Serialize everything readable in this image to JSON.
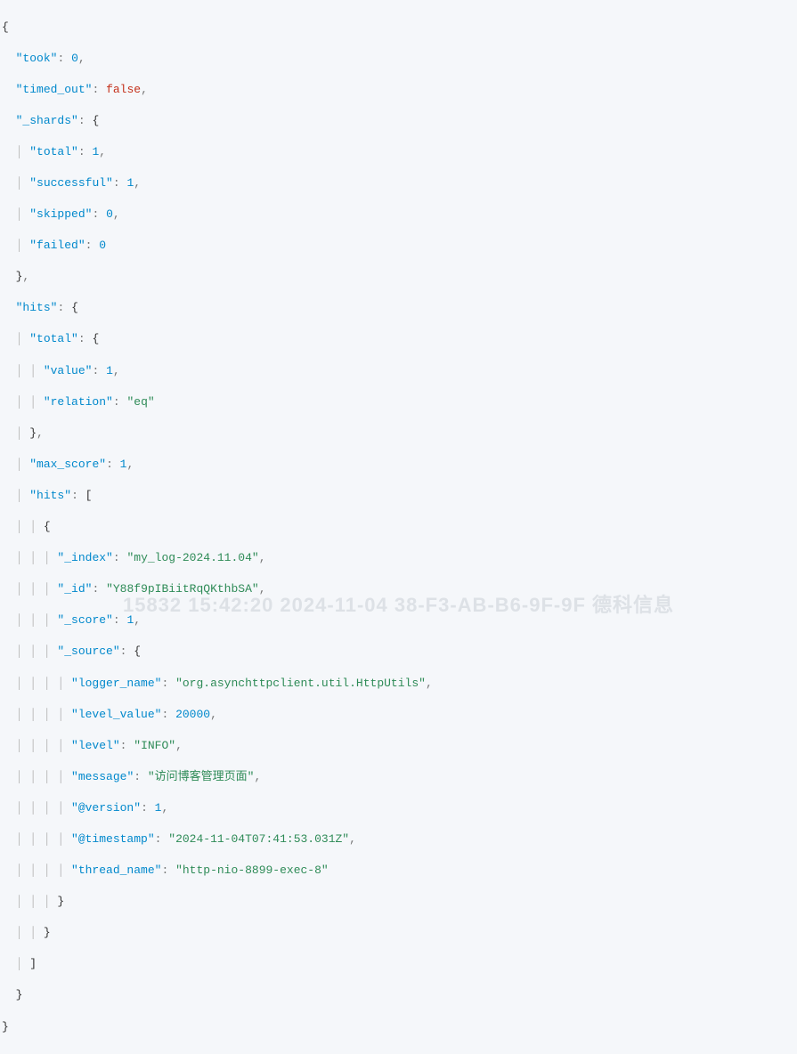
{
  "json": {
    "took": {
      "key": "took",
      "value": "0",
      "type": "number"
    },
    "timed_out": {
      "key": "timed_out",
      "value": "false",
      "type": "boolean"
    },
    "shards": {
      "key": "_shards",
      "total": {
        "key": "total",
        "value": "1",
        "type": "number"
      },
      "successful": {
        "key": "successful",
        "value": "1",
        "type": "number"
      },
      "skipped": {
        "key": "skipped",
        "value": "0",
        "type": "number"
      },
      "failed": {
        "key": "failed",
        "value": "0",
        "type": "number"
      }
    },
    "hits": {
      "key": "hits",
      "total": {
        "key": "total",
        "value_k": {
          "key": "value",
          "value": "1",
          "type": "number"
        },
        "relation": {
          "key": "relation",
          "value": "\"eq\"",
          "type": "string"
        }
      },
      "max_score": {
        "key": "max_score",
        "value": "1",
        "type": "number"
      },
      "hits_arr": {
        "key": "hits",
        "item": {
          "index": {
            "key": "_index",
            "value": "\"my_log-2024.11.04\"",
            "type": "string"
          },
          "id": {
            "key": "_id",
            "value": "\"Y88f9pIBiitRqQKthbSA\"",
            "type": "string"
          },
          "score": {
            "key": "_score",
            "value": "1",
            "type": "number"
          },
          "source": {
            "key": "_source",
            "logger_name": {
              "key": "logger_name",
              "value": "\"org.asynchttpclient.util.HttpUtils\"",
              "type": "string"
            },
            "level_value": {
              "key": "level_value",
              "value": "20000",
              "type": "number"
            },
            "level": {
              "key": "level",
              "value": "\"INFO\"",
              "type": "string"
            },
            "message": {
              "key": "message",
              "value": "\"访问博客管理页面\"",
              "type": "string"
            },
            "version": {
              "key": "@version",
              "value": "1",
              "type": "number"
            },
            "timestamp": {
              "key": "@timestamp",
              "value": "\"2024-11-04T07:41:53.031Z\"",
              "type": "string"
            },
            "thread_name": {
              "key": "thread_name",
              "value": "\"http-nio-8899-exec-8\"",
              "type": "string"
            }
          }
        }
      }
    }
  },
  "watermark": {
    "text": "15832  15:42:20  2024-11-04  38-F3-AB-B6-9F-9F  德科信息"
  }
}
